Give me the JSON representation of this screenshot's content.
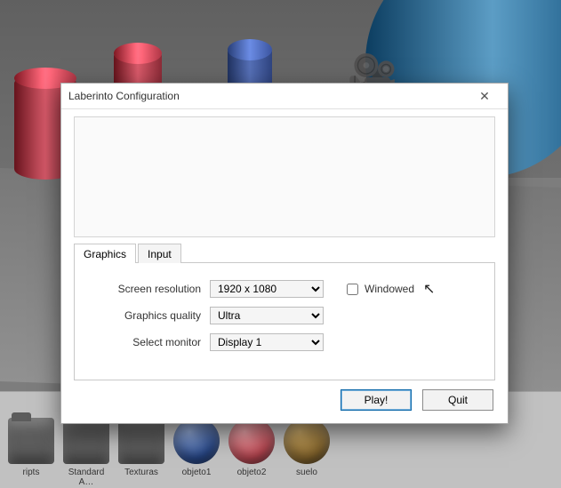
{
  "dialog": {
    "title": "Laberinto Configuration",
    "tabs": {
      "graphics": "Graphics",
      "input": "Input"
    },
    "fields": {
      "resolution_label": "Screen resolution",
      "resolution_value": "1920 x 1080",
      "quality_label": "Graphics quality",
      "quality_value": "Ultra",
      "monitor_label": "Select monitor",
      "monitor_value": "Display 1",
      "windowed_label": "Windowed"
    },
    "buttons": {
      "play": "Play!",
      "quit": "Quit"
    }
  },
  "assets": {
    "a0": "ripts",
    "a1": "Standard A…",
    "a2": "Texturas",
    "a3": "objeto1",
    "a4": "objeto2",
    "a5": "suelo"
  }
}
